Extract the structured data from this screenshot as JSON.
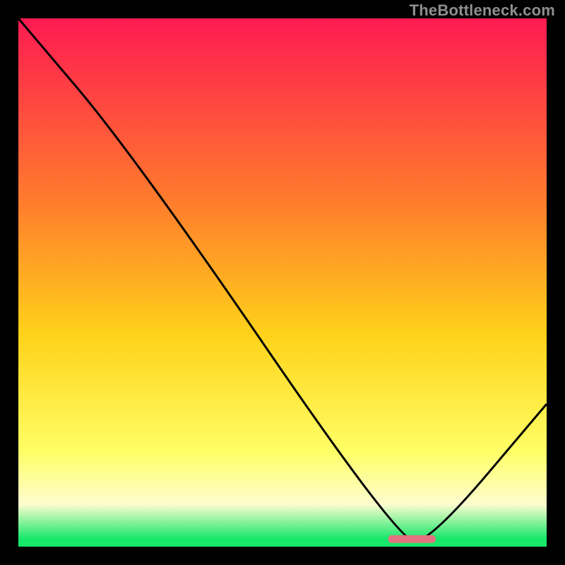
{
  "watermark": "TheBottleneck.com",
  "colors": {
    "bg": "#000000",
    "curve": "#000000",
    "marker": "#e27380",
    "grad_top": "#ff1a52",
    "grad_upper_mid": "#ff7a2d",
    "grad_mid": "#ffd21a",
    "grad_low_mid": "#ffff66",
    "grad_cream": "#fdfccf",
    "grad_green": "#17e86b"
  },
  "chart_data": {
    "type": "line",
    "title": "",
    "xlabel": "",
    "ylabel": "",
    "xlim": [
      0,
      100
    ],
    "ylim": [
      0,
      100
    ],
    "x": [
      0,
      22,
      72,
      78,
      100
    ],
    "values": [
      100,
      74,
      1,
      1,
      27
    ],
    "marker": {
      "x_start": 70,
      "x_end": 79,
      "y": 1.5
    },
    "gradient_stops": [
      {
        "offset": 0.0,
        "color": "#ff1a52"
      },
      {
        "offset": 0.34,
        "color": "#ff7a2d"
      },
      {
        "offset": 0.6,
        "color": "#ffd21a"
      },
      {
        "offset": 0.82,
        "color": "#ffff66"
      },
      {
        "offset": 0.92,
        "color": "#fdfccf"
      },
      {
        "offset": 0.985,
        "color": "#17e86b"
      },
      {
        "offset": 1.0,
        "color": "#17e86b"
      }
    ]
  }
}
